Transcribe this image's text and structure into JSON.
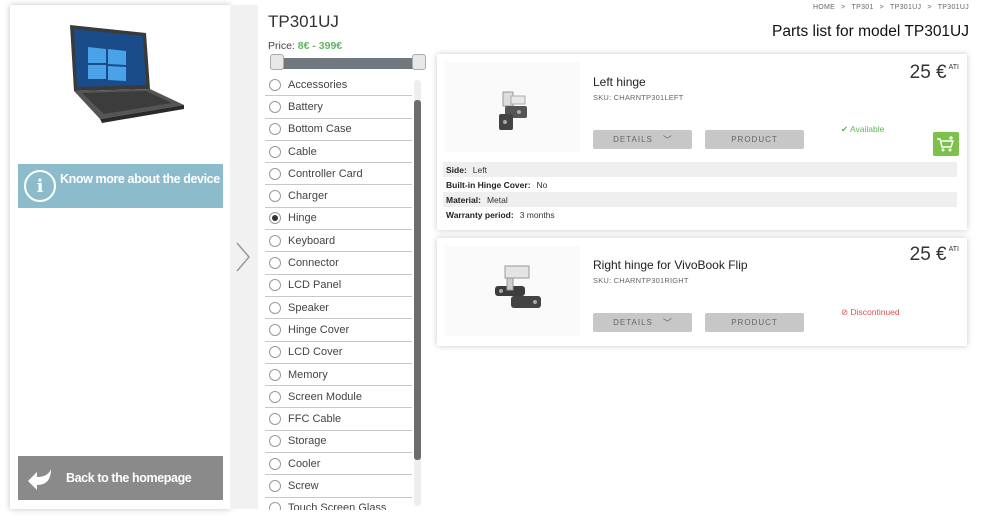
{
  "device_panel": {
    "know_more_label": "Know more about the device",
    "back_home_label": "Back to the homepage"
  },
  "filters": {
    "model_title": "TP301UJ",
    "price_label": "Price:",
    "price_range": "8€ - 399€",
    "categories": [
      {
        "label": "Accessories",
        "selected": false
      },
      {
        "label": "Battery",
        "selected": false
      },
      {
        "label": "Bottom Case",
        "selected": false
      },
      {
        "label": "Cable",
        "selected": false
      },
      {
        "label": "Controller Card",
        "selected": false
      },
      {
        "label": "Charger",
        "selected": false
      },
      {
        "label": "Hinge",
        "selected": true
      },
      {
        "label": "Keyboard",
        "selected": false
      },
      {
        "label": "Connector",
        "selected": false
      },
      {
        "label": "LCD Panel",
        "selected": false
      },
      {
        "label": "Speaker",
        "selected": false
      },
      {
        "label": "Hinge Cover",
        "selected": false
      },
      {
        "label": "LCD Cover",
        "selected": false
      },
      {
        "label": "Memory",
        "selected": false
      },
      {
        "label": "Screen Module",
        "selected": false
      },
      {
        "label": "FFC Cable",
        "selected": false
      },
      {
        "label": "Storage",
        "selected": false
      },
      {
        "label": "Cooler",
        "selected": false
      },
      {
        "label": "Screw",
        "selected": false
      },
      {
        "label": "Touch Screen Glass",
        "selected": false
      }
    ]
  },
  "breadcrumb": [
    "HOME",
    ">",
    "TP301",
    ">",
    "TP301UJ",
    ">",
    "TP301UJ"
  ],
  "heading": "Parts list for model TP301UJ",
  "parts": [
    {
      "title": "Left hinge",
      "sku": "SKU: CHARNTP301LEFT",
      "price": "25 €",
      "price_suffix": "ATI",
      "details_label": "DETAILS",
      "product_label": "PRODUCT",
      "status": "✔ Available",
      "specs": [
        {
          "key": "Side:",
          "value": "Left"
        },
        {
          "key": "Built-in Hinge Cover:",
          "value": "No"
        },
        {
          "key": "Material:",
          "value": "Metal"
        },
        {
          "key": "Warranty period:",
          "value": "3 months"
        }
      ]
    },
    {
      "title": "Right hinge for VivoBook Flip",
      "sku": "SKU: CHARNTP301RIGHT",
      "price": "25 €",
      "price_suffix": "ATI",
      "details_label": "DETAILS",
      "product_label": "PRODUCT",
      "status": "⊘ Discontinued"
    }
  ],
  "colors": {
    "accent_green": "#5cb85c",
    "know_more_bg": "#8cbccb",
    "back_home_bg": "#8a8a8a",
    "discontinued_red": "#d9534f",
    "cart_green": "#7cc24a"
  }
}
